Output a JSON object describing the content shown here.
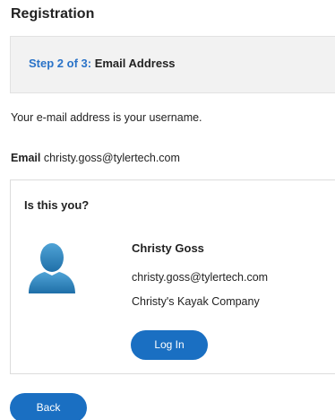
{
  "header": {
    "title": "Registration"
  },
  "step": {
    "prefix": "Step 2 of 3:",
    "name": "Email Address"
  },
  "note": "Your e-mail address is your username.",
  "email": {
    "label": "Email",
    "value": "christy.goss@tylertech.com"
  },
  "card": {
    "title": "Is this you?",
    "avatar_icon": "user-silhouette-icon",
    "user_name": "Christy Goss",
    "user_email": "christy.goss@tylertech.com",
    "company": "Christy's Kayak Company",
    "login_label": "Log In"
  },
  "footer": {
    "back_label": "Back"
  },
  "colors": {
    "accent": "#1a6fc2",
    "step_prefix": "#2a73c8",
    "avatar": "#2f86bf"
  }
}
